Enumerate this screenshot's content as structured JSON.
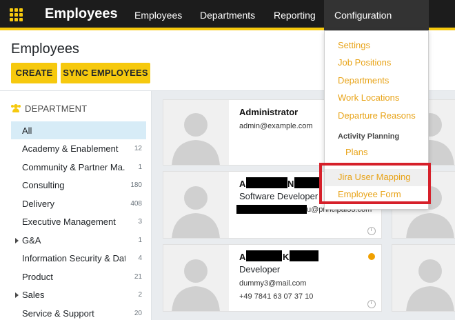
{
  "navbar": {
    "brand": "Employees",
    "menu": [
      "Employees",
      "Departments",
      "Reporting",
      "Configuration"
    ]
  },
  "control_panel": {
    "title": "Employees",
    "create_label": "CREATE",
    "sync_label": "SYNC EMPLOYEES"
  },
  "sidebar": {
    "header": "DEPARTMENT",
    "items": [
      {
        "label": "All",
        "count": ""
      },
      {
        "label": "Academy & Enablement",
        "count": "12"
      },
      {
        "label": "Community & Partner Ma...",
        "count": "1"
      },
      {
        "label": "Consulting",
        "count": "180"
      },
      {
        "label": "Delivery",
        "count": "408"
      },
      {
        "label": "Executive Management",
        "count": "3"
      },
      {
        "label": "G&A",
        "count": "1"
      },
      {
        "label": "Information Security & Dat...",
        "count": "4"
      },
      {
        "label": "Product",
        "count": "21"
      },
      {
        "label": "Sales",
        "count": "2"
      },
      {
        "label": "Service & Support",
        "count": "20"
      }
    ]
  },
  "cards": [
    {
      "name": "Administrator",
      "email": "admin@example.com",
      "job": "",
      "phone": ""
    },
    {
      "name_prefix": "A",
      "name_mid": "N",
      "job": "Software Developer",
      "email_suffix": "u@principal33.com"
    },
    {
      "name_prefix": "A",
      "name_mid": "K",
      "job": "Developer",
      "email": "dummy3@mail.com",
      "phone": "+49 7841 63 07 37 10"
    }
  ],
  "dropdown": {
    "items": [
      "Settings",
      "Job Positions",
      "Departments",
      "Work Locations",
      "Departure Reasons"
    ],
    "section": "Activity Planning",
    "section_items": [
      "Plans"
    ],
    "highlighted": [
      "Jira User Mapping",
      "Employee Form"
    ]
  },
  "colors": {
    "accent": "#f6c90e",
    "navbar": "#1c1c1c",
    "menu_link": "#e8a317",
    "annotation": "#d6202a"
  }
}
